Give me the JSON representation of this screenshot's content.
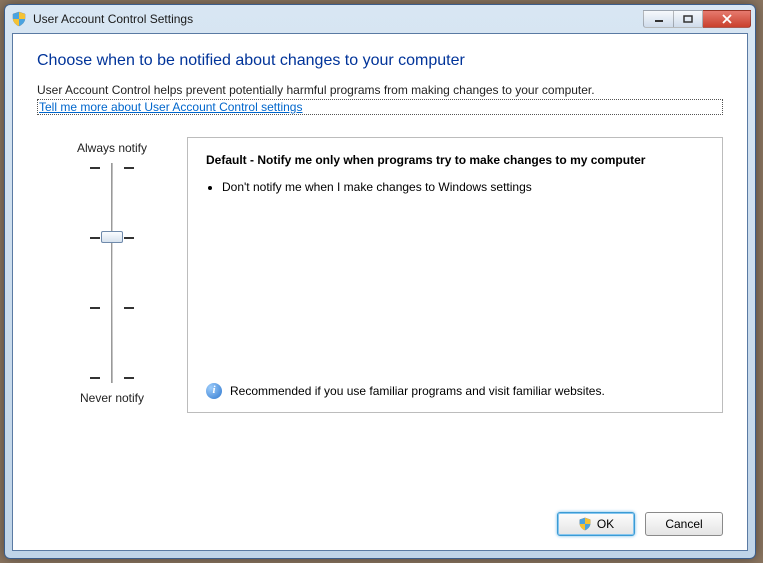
{
  "window": {
    "title": "User Account Control Settings"
  },
  "content": {
    "heading": "Choose when to be notified about changes to your computer",
    "intro": "User Account Control helps prevent potentially harmful programs from making changes to your computer.",
    "help_link": "Tell me more about User Account Control settings",
    "slider": {
      "top_label": "Always notify",
      "bottom_label": "Never notify",
      "levels": 4,
      "current_level": 2
    },
    "description": {
      "title": "Default - Notify me only when programs try to make changes to my computer",
      "bullets": [
        "Don't notify me when I make changes to Windows settings"
      ],
      "recommendation": "Recommended if you use familiar programs and visit familiar websites."
    }
  },
  "buttons": {
    "ok": "OK",
    "cancel": "Cancel"
  }
}
